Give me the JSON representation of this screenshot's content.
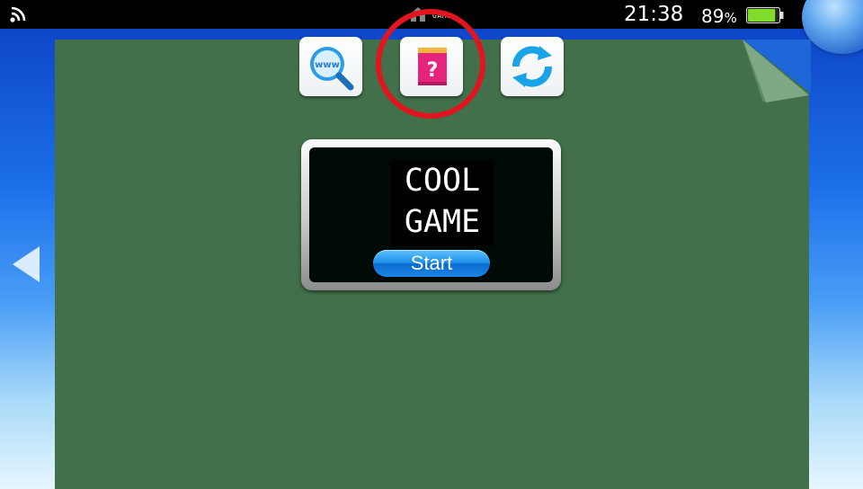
{
  "status_bar": {
    "app_label": "GAME",
    "time": "21:38",
    "battery_percent": "89",
    "battery_unit": "%",
    "battery_level": 0.89
  },
  "toolbar": {
    "buttons": [
      {
        "name": "browser",
        "icon": "www-search-icon"
      },
      {
        "name": "manual",
        "icon": "help-manual-icon"
      },
      {
        "name": "refresh",
        "icon": "refresh-icon"
      }
    ]
  },
  "game_card": {
    "title_line1": "COOL",
    "title_line2": "GAME",
    "start_label": "Start"
  },
  "colors": {
    "sheet": "#42704a",
    "highlight_ring": "#e2141e",
    "start_button": "#1a8fe8",
    "manual_icon": "#e6247e",
    "refresh_icon": "#1aa3e6",
    "battery": "#7fdc2a"
  }
}
